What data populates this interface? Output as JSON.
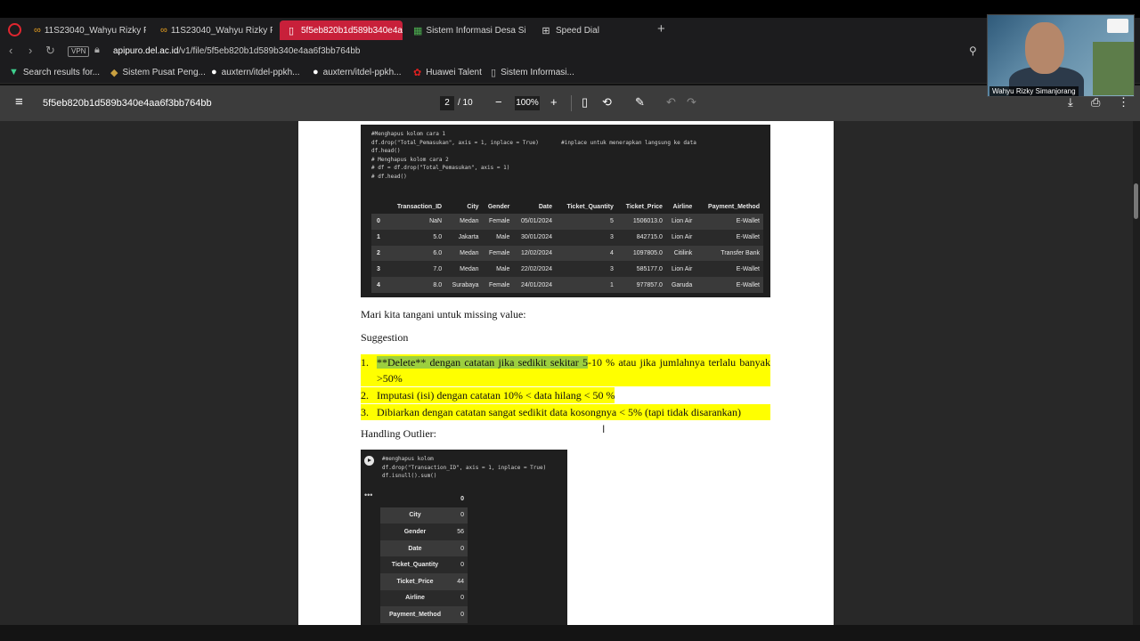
{
  "browser": {
    "tabs": [
      {
        "label": "11S23040_Wahyu Rizky F",
        "icon": "infinity-icon"
      },
      {
        "label": "11S23040_Wahyu Rizky F",
        "icon": "infinity-icon"
      },
      {
        "label": "5f5eb820b1d589b340e4a",
        "icon": "pdf-icon",
        "active": true
      },
      {
        "label": "Sistem Informasi Desa Sib",
        "icon": "grid-icon"
      },
      {
        "label": "Speed Dial",
        "icon": "speed-dial-icon"
      }
    ],
    "vpn_label": "VPN",
    "url_host": "apipuro.del.ac.id",
    "url_path": "/v1/file/5f5eb820b1d589b340e4aa6f3bb764bb",
    "bookmarks": [
      {
        "label": "Search results for...",
        "icon": "v-icon"
      },
      {
        "label": "Sistem Pusat Peng...",
        "icon": "crest-icon"
      },
      {
        "label": "auxtern/itdel-ppkh...",
        "icon": "github-icon"
      },
      {
        "label": "auxtern/itdel-ppkh...",
        "icon": "github-icon"
      },
      {
        "label": "Huawei Talent",
        "icon": "huawei-icon"
      },
      {
        "label": "Sistem Informasi...",
        "icon": "file-icon"
      }
    ]
  },
  "pdf": {
    "title": "5f5eb820b1d589b340e4aa6f3bb764bb",
    "page_current": "2",
    "page_total": "/ 10",
    "zoom": "100%"
  },
  "content": {
    "code1_lines": [
      "#Menghapus kolom cara 1",
      "df.drop(\"Total_Pemasukan\", axis = 1, inplace = True)       #inplace untuk menerapkan langsung ke data",
      "df.head()",
      "",
      "# Menghapus kolom cara 2",
      "# df = df.drop(\"Total_Pemasukan\", axis = 1)",
      "# df.head()"
    ],
    "table_headers": [
      "",
      "Transaction_ID",
      "City",
      "Gender",
      "Date",
      "Ticket_Quantity",
      "Ticket_Price",
      "Airline",
      "Payment_Method"
    ],
    "table_rows": [
      [
        "0",
        "NaN",
        "Medan",
        "Female",
        "05/01/2024",
        "5",
        "1506013.0",
        "Lion Air",
        "E-Wallet"
      ],
      [
        "1",
        "5.0",
        "Jakarta",
        "Male",
        "30/01/2024",
        "3",
        "842715.0",
        "Lion Air",
        "E-Wallet"
      ],
      [
        "2",
        "6.0",
        "Medan",
        "Female",
        "12/02/2024",
        "4",
        "1097805.0",
        "Citilink",
        "Transfer Bank"
      ],
      [
        "3",
        "7.0",
        "Medan",
        "Male",
        "22/02/2024",
        "3",
        "585177.0",
        "Lion Air",
        "E-Wallet"
      ],
      [
        "4",
        "8.0",
        "Surabaya",
        "Female",
        "24/01/2024",
        "1",
        "977857.0",
        "Garuda",
        "E-Wallet"
      ]
    ],
    "para1": "Mari kita tangani untuk missing value:",
    "para2": "Suggestion",
    "list": [
      {
        "num": "1.",
        "green_part": "**Delete** dengan catatan jika sedikit sekitar 5",
        "rest": "-10 % atau jika jumlahnya terlalu banyak >50%"
      },
      {
        "num": "2.",
        "text": "Imputasi (isi) dengan catatan 10% < data hilang < 50 %"
      },
      {
        "num": "3.",
        "text": "Dibiarkan dengan catatan sangat sedikit data kosongnya < 5% (tapi tidak disarankan)"
      }
    ],
    "para3": "Handling Outlier:",
    "code2_lines": [
      "#menghapus kolom",
      "df.drop(\"Transaction_ID\", axis = 1, inplace = True)",
      "df.isnull().sum()"
    ],
    "output_dots": "•••",
    "null_header": "0",
    "null_rows": [
      [
        "City",
        "0"
      ],
      [
        "Gender",
        "56"
      ],
      [
        "Date",
        "0"
      ],
      [
        "Ticket_Quantity",
        "0"
      ],
      [
        "Ticket_Price",
        "44"
      ],
      [
        "Airline",
        "0"
      ],
      [
        "Payment_Method",
        "0"
      ]
    ]
  },
  "webcam": {
    "name": "Wahyu Rizky Simanjorang"
  }
}
